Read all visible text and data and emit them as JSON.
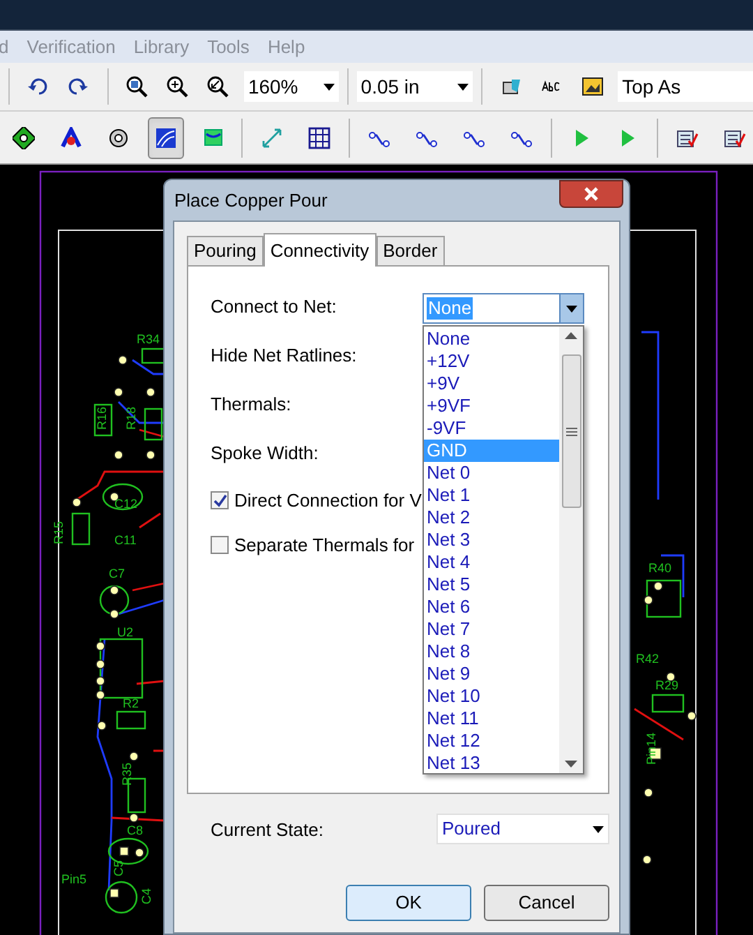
{
  "menu": [
    {
      "label": "d"
    },
    {
      "label": "Verification"
    },
    {
      "label": "Library"
    },
    {
      "label": "Tools"
    },
    {
      "label": "Help"
    }
  ],
  "toolbar": {
    "zoom": "160%",
    "grid": "0.05 in",
    "layer": "Top As"
  },
  "toolbar2": [
    {
      "kind": "pad",
      "selected": false
    },
    {
      "kind": "arc",
      "selected": false
    },
    {
      "kind": "via",
      "selected": false
    },
    {
      "kind": "pour",
      "selected": true
    },
    {
      "kind": "plane",
      "selected": false
    },
    {
      "kind": "measure",
      "selected": false
    },
    {
      "kind": "grid",
      "selected": false
    },
    {
      "kind": "trace",
      "selected": false
    },
    {
      "kind": "trace",
      "selected": false
    },
    {
      "kind": "trace",
      "selected": false
    },
    {
      "kind": "trace",
      "selected": false
    },
    {
      "kind": "run",
      "selected": false
    },
    {
      "kind": "run",
      "selected": false
    },
    {
      "kind": "drc",
      "selected": false
    },
    {
      "kind": "drc",
      "selected": false
    }
  ],
  "pcb": {
    "labels": [
      "R34",
      "R16",
      "R18",
      "C12",
      "R15",
      "C11",
      "C7",
      "U2",
      "R2",
      "R35",
      "C8",
      "C5",
      "Pin5",
      "C4",
      "R40",
      "R42",
      "R29",
      "Pin14"
    ]
  },
  "dialog": {
    "title": "Place Copper Pour",
    "tabs": [
      {
        "label": "Pouring",
        "selected": false
      },
      {
        "label": "Connectivity",
        "selected": true
      },
      {
        "label": "Border",
        "selected": false
      }
    ],
    "fields": [
      {
        "label": "Connect to Net:"
      },
      {
        "label": "Hide Net Ratlines:"
      },
      {
        "label": "Thermals:"
      },
      {
        "label": "Spoke Width:"
      }
    ],
    "net_combo": {
      "value": "None"
    },
    "net_list": [
      {
        "label": "None",
        "selected": false
      },
      {
        "label": "+12V",
        "selected": false
      },
      {
        "label": "+9V",
        "selected": false
      },
      {
        "label": "+9VF",
        "selected": false
      },
      {
        "label": "-9VF",
        "selected": false
      },
      {
        "label": "GND",
        "selected": true
      },
      {
        "label": "Net 0",
        "selected": false
      },
      {
        "label": "Net 1",
        "selected": false
      },
      {
        "label": "Net 2",
        "selected": false
      },
      {
        "label": "Net 3",
        "selected": false
      },
      {
        "label": "Net 4",
        "selected": false
      },
      {
        "label": "Net 5",
        "selected": false
      },
      {
        "label": "Net 6",
        "selected": false
      },
      {
        "label": "Net 7",
        "selected": false
      },
      {
        "label": "Net 8",
        "selected": false
      },
      {
        "label": "Net 9",
        "selected": false
      },
      {
        "label": "Net 10",
        "selected": false
      },
      {
        "label": "Net 11",
        "selected": false
      },
      {
        "label": "Net 12",
        "selected": false
      },
      {
        "label": "Net 13",
        "selected": false
      }
    ],
    "checkboxes": [
      {
        "label": "Direct Connection for V",
        "checked": true
      },
      {
        "label": "Separate Thermals for",
        "checked": false
      }
    ],
    "current_state": {
      "label": "Current State:",
      "value": "Poured"
    },
    "buttons": [
      "OK",
      "Cancel"
    ]
  }
}
